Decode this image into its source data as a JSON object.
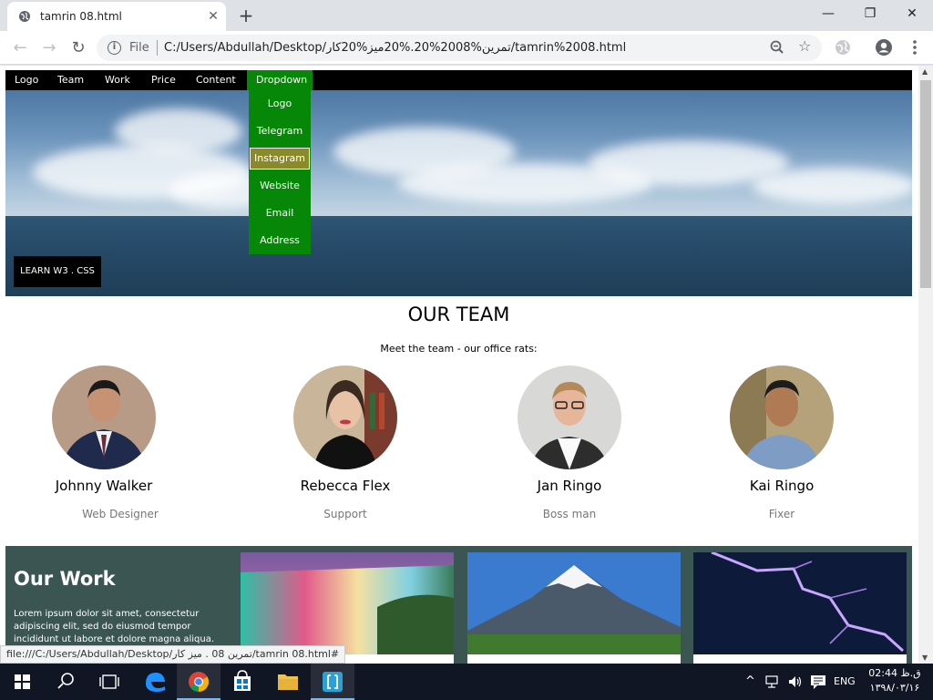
{
  "browser": {
    "tab_title": "tamrin 08.html",
    "tab_close": "✕",
    "new_tab": "+",
    "scheme_label": "File",
    "url": "C:/Users/Abdullah/Desktop/تمرین%2008%20.%20میز%20کار/tamrin%2008.html",
    "window_minimize": "—",
    "window_restore": "❐",
    "window_close": "✕"
  },
  "nav": {
    "items": [
      "Logo",
      "Team",
      "Work",
      "Price",
      "Content"
    ],
    "dropdown_label": "Dropdown",
    "dropdown_items": [
      "Logo",
      "Telegram",
      "Instagram",
      "Website",
      "Email",
      "Address"
    ],
    "dropdown_active_index": 2
  },
  "hero": {
    "button_label": "LEARN W3 . CSS"
  },
  "team": {
    "title": "OUR TEAM",
    "subtitle": "Meet the team - our office rats:",
    "members": [
      {
        "name": "Johnny Walker",
        "role": "Web Designer"
      },
      {
        "name": "Rebecca Flex",
        "role": "Support"
      },
      {
        "name": "Jan Ringo",
        "role": "Boss man"
      },
      {
        "name": "Kai Ringo",
        "role": "Fixer"
      }
    ]
  },
  "work": {
    "title": "Our Work",
    "text": "Lorem ipsum dolor sit amet, consectetur adipiscing elit, sed do eiusmod tempor incididunt ut labore et dolore magna aliqua."
  },
  "status": {
    "link": "file:///C:/Users/Abdullah/Desktop/تمرین 08 . میز کار/tamrin 08.html#"
  },
  "taskbar": {
    "language": "ENG",
    "time": "02:44 ق.ظ",
    "date": "۱۳۹۸/۰۳/۱۶"
  }
}
